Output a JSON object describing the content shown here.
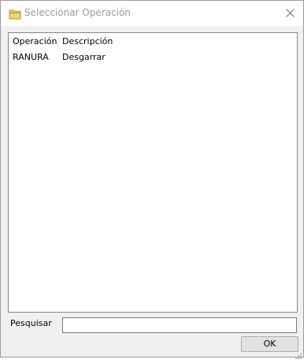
{
  "window": {
    "title": "Seleccionar Operación",
    "icon": "folder-icon",
    "close_icon": "close-icon"
  },
  "list": {
    "columns": [
      "Operación",
      "Descripción"
    ],
    "rows": [
      [
        "RANURA",
        "Desgarrar"
      ]
    ]
  },
  "search": {
    "label": "Pesquisar",
    "value": ""
  },
  "buttons": {
    "ok_label": "OK"
  },
  "colors": {
    "folder": "#e8c04a",
    "title_text": "#9b9b9b",
    "dialog_bg": "#f0f0f0"
  }
}
